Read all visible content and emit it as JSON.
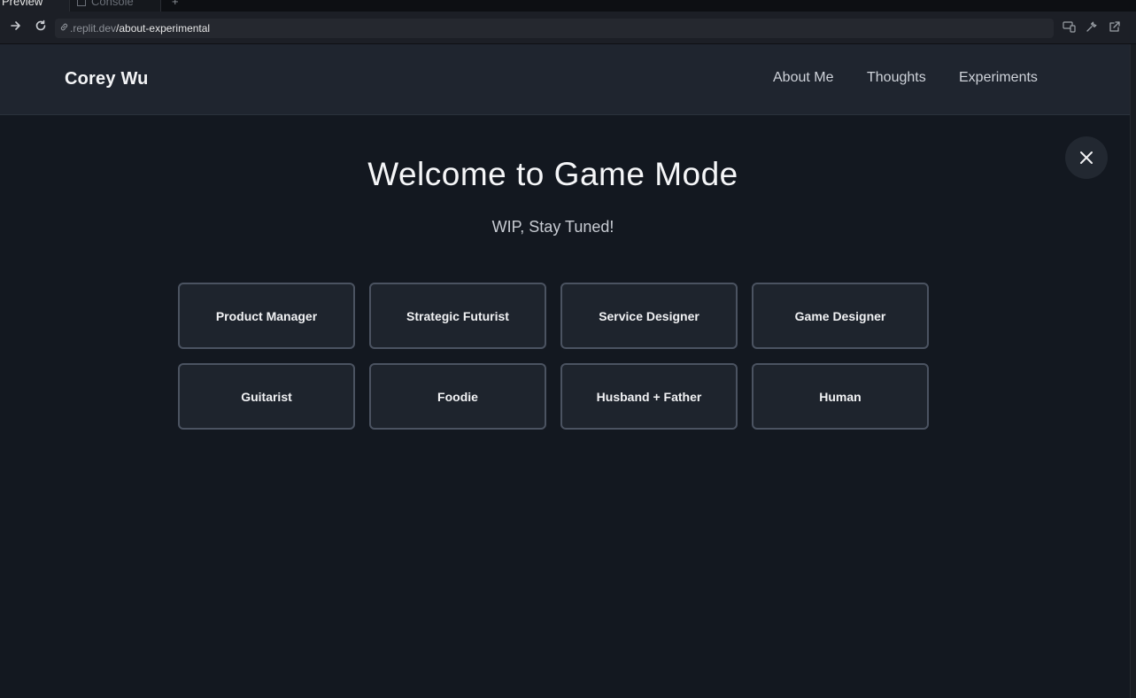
{
  "browser": {
    "tabs": [
      {
        "label": "Preview"
      },
      {
        "label": "Console"
      }
    ],
    "add_tab": "+",
    "url": {
      "domain": ".replit.dev",
      "path": "/about-experimental"
    }
  },
  "site": {
    "brand": "Corey Wu",
    "nav": [
      {
        "label": "About Me"
      },
      {
        "label": "Thoughts"
      },
      {
        "label": "Experiments"
      }
    ],
    "title": "Welcome to Game Mode",
    "subtitle": "WIP, Stay Tuned!",
    "roles": [
      {
        "label": "Product Manager"
      },
      {
        "label": "Strategic Futurist"
      },
      {
        "label": "Service Designer"
      },
      {
        "label": "Game Designer"
      },
      {
        "label": "Guitarist"
      },
      {
        "label": "Foodie"
      },
      {
        "label": "Husband + Father"
      },
      {
        "label": "Human"
      }
    ]
  },
  "colors": {
    "background": "#131820",
    "header": "#1f252f",
    "card": "#1e242d",
    "card_border": "#4b5361"
  },
  "icons": [
    "arrow-right-icon",
    "reload-icon",
    "link-icon",
    "devices-icon",
    "wrench-icon",
    "external-link-icon",
    "close-icon"
  ]
}
